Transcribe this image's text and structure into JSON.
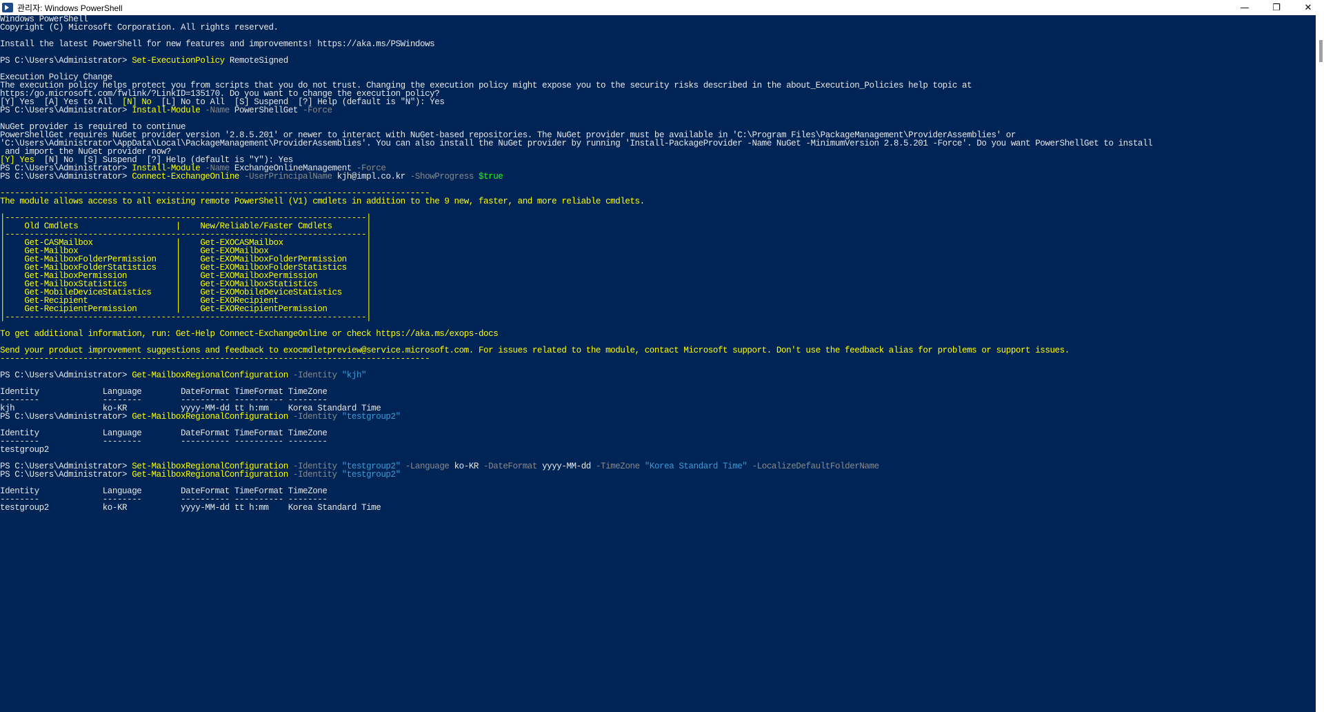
{
  "window": {
    "title": "관리자: Windows PowerShell",
    "minimize_glyph": "—",
    "restore_glyph": "❐",
    "close_glyph": "✕"
  },
  "colors": {
    "background": "#012456",
    "default": "#e8e8e8",
    "yellow": "#ffff00",
    "gray": "#8a8a8a",
    "cyan": "#3c9ad6",
    "green": "#13ff13"
  },
  "lines": [
    [
      {
        "t": "Windows PowerShell",
        "c": "d"
      }
    ],
    [
      {
        "t": "Copyright (C) Microsoft Corporation. All rights reserved.",
        "c": "d"
      }
    ],
    [
      {
        "t": "",
        "c": "d"
      }
    ],
    [
      {
        "t": "Install the latest PowerShell for new features and improvements! https://aka.ms/PSWindows",
        "c": "d"
      }
    ],
    [
      {
        "t": "",
        "c": "d"
      }
    ],
    [
      {
        "t": "PS C:\\Users\\Administrator> ",
        "c": "d"
      },
      {
        "t": "Set-ExecutionPolicy",
        "c": "y"
      },
      {
        "t": " RemoteSigned",
        "c": "d"
      }
    ],
    [
      {
        "t": "",
        "c": "d"
      }
    ],
    [
      {
        "t": "Execution Policy Change",
        "c": "d"
      }
    ],
    [
      {
        "t": "The execution policy helps protect you from scripts that you do not trust. Changing the execution policy might expose you to the security risks described in the about_Execution_Policies help topic at",
        "c": "d"
      }
    ],
    [
      {
        "t": "https:/go.microsoft.com/fwlink/?LinkID=135170. Do you want to change the execution policy?",
        "c": "d"
      }
    ],
    [
      {
        "t": "[Y] Yes  [A] Yes to All  ",
        "c": "d"
      },
      {
        "t": "[N] No",
        "c": "y"
      },
      {
        "t": "  [L] No to All  [S] Suspend  [?] Help (default is \"N\"): Yes",
        "c": "d"
      }
    ],
    [
      {
        "t": "PS C:\\Users\\Administrator> ",
        "c": "d"
      },
      {
        "t": "Install-Module",
        "c": "y"
      },
      {
        "t": " -Name",
        "c": "g"
      },
      {
        "t": " PowerShellGet",
        "c": "d"
      },
      {
        "t": " -Force",
        "c": "g"
      }
    ],
    [
      {
        "t": "",
        "c": "d"
      }
    ],
    [
      {
        "t": "NuGet provider is required to continue",
        "c": "d"
      }
    ],
    [
      {
        "t": "PowerShellGet requires NuGet provider version '2.8.5.201' or newer to interact with NuGet-based repositories. The NuGet provider must be available in 'C:\\Program Files\\PackageManagement\\ProviderAssemblies' or",
        "c": "d"
      }
    ],
    [
      {
        "t": "'C:\\Users\\Administrator\\AppData\\Local\\PackageManagement\\ProviderAssemblies'. You can also install the NuGet provider by running 'Install-PackageProvider -Name NuGet -MinimumVersion 2.8.5.201 -Force'. Do you want PowerShellGet to install",
        "c": "d"
      }
    ],
    [
      {
        "t": " and import the NuGet provider now?",
        "c": "d"
      }
    ],
    [
      {
        "t": "[Y] Yes",
        "c": "y"
      },
      {
        "t": "  [N] No  [S] Suspend  [?] Help (default is \"Y\"): Yes",
        "c": "d"
      }
    ],
    [
      {
        "t": "PS C:\\Users\\Administrator> ",
        "c": "d"
      },
      {
        "t": "Install-Module",
        "c": "y"
      },
      {
        "t": " -Name",
        "c": "g"
      },
      {
        "t": " ExchangeOnlineManagement",
        "c": "d"
      },
      {
        "t": " -Force",
        "c": "g"
      }
    ],
    [
      {
        "t": "PS C:\\Users\\Administrator> ",
        "c": "d"
      },
      {
        "t": "Connect-ExchangeOnline",
        "c": "y"
      },
      {
        "t": " -UserPrincipalName",
        "c": "g"
      },
      {
        "t": " kjh@impl.co.kr",
        "c": "d"
      },
      {
        "t": " -ShowProgress",
        "c": "g"
      },
      {
        "t": " $true",
        "c": "n"
      }
    ],
    [
      {
        "t": "",
        "c": "d"
      }
    ],
    [
      {
        "t": "----------------------------------------------------------------------------------------",
        "c": "y"
      }
    ],
    [
      {
        "t": "The module allows access to all existing remote PowerShell (V1) cmdlets in addition to the 9 new, faster, and more reliable cmdlets.",
        "c": "y"
      }
    ],
    [
      {
        "t": "",
        "c": "d"
      }
    ],
    [
      {
        "t": "|--------------------------------------------------------------------------|",
        "c": "y"
      }
    ],
    [
      {
        "t": "|    Old Cmdlets                    |    New/Reliable/Faster Cmdlets       |",
        "c": "y"
      }
    ],
    [
      {
        "t": "|--------------------------------------------------------------------------|",
        "c": "y"
      }
    ],
    [
      {
        "t": "|    Get-CASMailbox                 |    Get-EXOCASMailbox                 |",
        "c": "y"
      }
    ],
    [
      {
        "t": "|    Get-Mailbox                    |    Get-EXOMailbox                    |",
        "c": "y"
      }
    ],
    [
      {
        "t": "|    Get-MailboxFolderPermission    |    Get-EXOMailboxFolderPermission    |",
        "c": "y"
      }
    ],
    [
      {
        "t": "|    Get-MailboxFolderStatistics    |    Get-EXOMailboxFolderStatistics    |",
        "c": "y"
      }
    ],
    [
      {
        "t": "|    Get-MailboxPermission          |    Get-EXOMailboxPermission          |",
        "c": "y"
      }
    ],
    [
      {
        "t": "|    Get-MailboxStatistics          |    Get-EXOMailboxStatistics          |",
        "c": "y"
      }
    ],
    [
      {
        "t": "|    Get-MobileDeviceStatistics     |    Get-EXOMobileDeviceStatistics     |",
        "c": "y"
      }
    ],
    [
      {
        "t": "|    Get-Recipient                  |    Get-EXORecipient                  |",
        "c": "y"
      }
    ],
    [
      {
        "t": "|    Get-RecipientPermission        |    Get-EXORecipientPermission        |",
        "c": "y"
      }
    ],
    [
      {
        "t": "|--------------------------------------------------------------------------|",
        "c": "y"
      }
    ],
    [
      {
        "t": "",
        "c": "d"
      }
    ],
    [
      {
        "t": "To get additional information, run: Get-Help Connect-ExchangeOnline or check https://aka.ms/exops-docs",
        "c": "y"
      }
    ],
    [
      {
        "t": "",
        "c": "d"
      }
    ],
    [
      {
        "t": "Send your product improvement suggestions and feedback to exocmdletpreview@service.microsoft.com. For issues related to the module, contact Microsoft support. Don't use the feedback alias for problems or support issues.",
        "c": "y"
      }
    ],
    [
      {
        "t": "----------------------------------------------------------------------------------------",
        "c": "y"
      }
    ],
    [
      {
        "t": "",
        "c": "d"
      }
    ],
    [
      {
        "t": "PS C:\\Users\\Administrator> ",
        "c": "d"
      },
      {
        "t": "Get-MailboxRegionalConfiguration",
        "c": "y"
      },
      {
        "t": " -Identity",
        "c": "g"
      },
      {
        "t": " \"kjh\"",
        "c": "c"
      }
    ],
    [
      {
        "t": "",
        "c": "d"
      }
    ],
    [
      {
        "t": "Identity             Language        DateFormat TimeFormat TimeZone",
        "c": "d"
      }
    ],
    [
      {
        "t": "--------             --------        ---------- ---------- --------",
        "c": "d"
      }
    ],
    [
      {
        "t": "kjh                  ko-KR           yyyy-MM-dd tt h:mm    Korea Standard Time",
        "c": "d"
      }
    ],
    [
      {
        "t": "PS C:\\Users\\Administrator> ",
        "c": "d"
      },
      {
        "t": "Get-MailboxRegionalConfiguration",
        "c": "y"
      },
      {
        "t": " -Identity",
        "c": "g"
      },
      {
        "t": " \"testgroup2\"",
        "c": "c"
      }
    ],
    [
      {
        "t": "",
        "c": "d"
      }
    ],
    [
      {
        "t": "Identity             Language        DateFormat TimeFormat TimeZone",
        "c": "d"
      }
    ],
    [
      {
        "t": "--------             --------        ---------- ---------- --------",
        "c": "d"
      }
    ],
    [
      {
        "t": "testgroup2",
        "c": "d"
      }
    ],
    [
      {
        "t": "",
        "c": "d"
      }
    ],
    [
      {
        "t": "PS C:\\Users\\Administrator> ",
        "c": "d"
      },
      {
        "t": "Set-MailboxRegionalConfiguration",
        "c": "y"
      },
      {
        "t": " -Identity",
        "c": "g"
      },
      {
        "t": " \"testgroup2\"",
        "c": "c"
      },
      {
        "t": " -Language",
        "c": "g"
      },
      {
        "t": " ko-KR",
        "c": "d"
      },
      {
        "t": " -DateFormat",
        "c": "g"
      },
      {
        "t": " yyyy-MM-dd",
        "c": "d"
      },
      {
        "t": " -TimeZone",
        "c": "g"
      },
      {
        "t": " \"Korea Standard Time\"",
        "c": "c"
      },
      {
        "t": " -LocalizeDefaultFolderName",
        "c": "g"
      }
    ],
    [
      {
        "t": "PS C:\\Users\\Administrator> ",
        "c": "d"
      },
      {
        "t": "Get-MailboxRegionalConfiguration",
        "c": "y"
      },
      {
        "t": " -Identity",
        "c": "g"
      },
      {
        "t": " \"testgroup2\"",
        "c": "c"
      }
    ],
    [
      {
        "t": "",
        "c": "d"
      }
    ],
    [
      {
        "t": "Identity             Language        DateFormat TimeFormat TimeZone",
        "c": "d"
      }
    ],
    [
      {
        "t": "--------             --------        ---------- ---------- --------",
        "c": "d"
      }
    ],
    [
      {
        "t": "testgroup2           ko-KR           yyyy-MM-dd tt h:mm    Korea Standard Time",
        "c": "d"
      }
    ]
  ]
}
